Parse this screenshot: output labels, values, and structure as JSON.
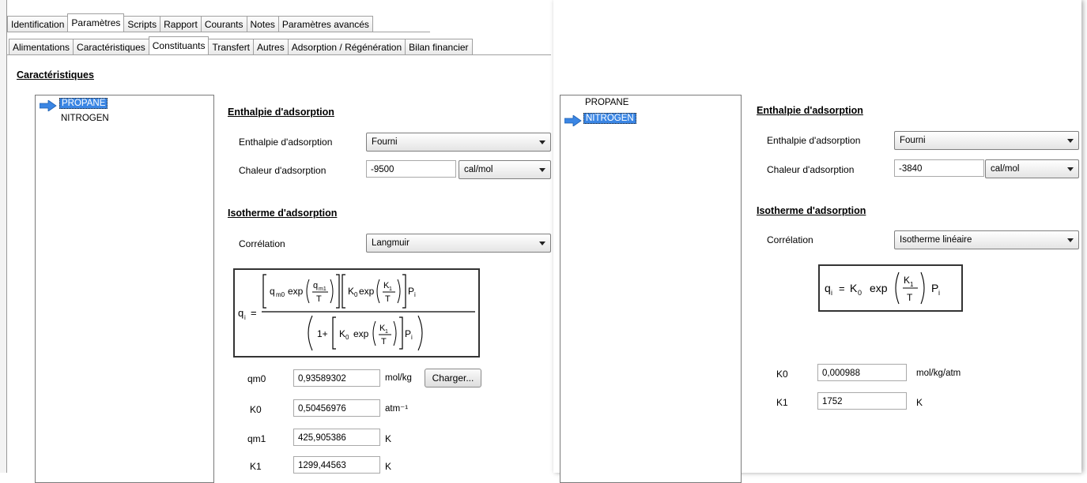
{
  "tabs_main": [
    "Identification",
    "Paramètres",
    "Scripts",
    "Rapport",
    "Courants",
    "Notes",
    "Paramètres avancés"
  ],
  "tabs_sub": [
    "Alimentations",
    "Caractéristiques",
    "Constituants",
    "Transfert",
    "Autres",
    "Adsorption / Régénération",
    "Bilan financier"
  ],
  "section_title": "Caractéristiques",
  "icons": {
    "selection": "arrow-right-icon",
    "dropdown": "chevron-down-icon"
  },
  "colors": {
    "selection": "#3b86e4",
    "arrow": "#3b86e4"
  },
  "left": {
    "components": [
      "PROPANE",
      "NITROGEN"
    ],
    "selected": "PROPANE",
    "enthalpy_title": "Enthalpie d'adsorption",
    "enthalpy_label": "Enthalpie d'adsorption",
    "enthalpy_value": "Fourni",
    "heat_label": "Chaleur d'adsorption",
    "heat_value": "-9500",
    "heat_unit": "cal/mol",
    "isotherm_title": "Isotherme d'adsorption",
    "correlation_label": "Corrélation",
    "correlation_value": "Langmuir",
    "formula": {
      "lhs": "q",
      "lhs_sub": "i",
      "eq": "=",
      "qm0": "q",
      "qm0_sub": "m0",
      "exp": "exp",
      "qm1": "q",
      "qm1_sub": "m1",
      "T": "T",
      "K0": "K",
      "K0_sub": "0",
      "K0exp": "exp",
      "K1": "K",
      "K1_sub": "1",
      "P": "P",
      "P_sub": "i",
      "one_plus": "1+"
    },
    "params": [
      {
        "name": "qm0",
        "value": "0,93589302",
        "unit": "mol/kg"
      },
      {
        "name": "K0",
        "value": "0,50456976",
        "unit": "atm⁻¹"
      },
      {
        "name": "qm1",
        "value": "425,905386",
        "unit": "K"
      },
      {
        "name": "K1",
        "value": "1299,44563",
        "unit": "K"
      }
    ],
    "charger_label": "Charger..."
  },
  "right": {
    "components": [
      "PROPANE",
      "NITROGEN"
    ],
    "selected": "NITROGEN",
    "enthalpy_title": "Enthalpie d'adsorption",
    "enthalpy_label": "Enthalpie d'adsorption",
    "enthalpy_value": "Fourni",
    "heat_label": "Chaleur d'adsorption",
    "heat_value": "-3840",
    "heat_unit": "cal/mol",
    "isotherm_title": "Isotherme d'adsorption",
    "correlation_label": "Corrélation",
    "correlation_value": "Isotherme linéaire",
    "formula": {
      "lhs": "q",
      "lhs_sub": "i",
      "eq": "=",
      "K0": "K",
      "K0_sub": "0",
      "exp": "exp",
      "K1": "K",
      "K1_sub": "1",
      "T": "T",
      "P": "P",
      "P_sub": "i"
    },
    "params": [
      {
        "name": "K0",
        "value": "0,000988",
        "unit": "mol/kg/atm"
      },
      {
        "name": "K1",
        "value": "1752",
        "unit": "K"
      }
    ]
  }
}
